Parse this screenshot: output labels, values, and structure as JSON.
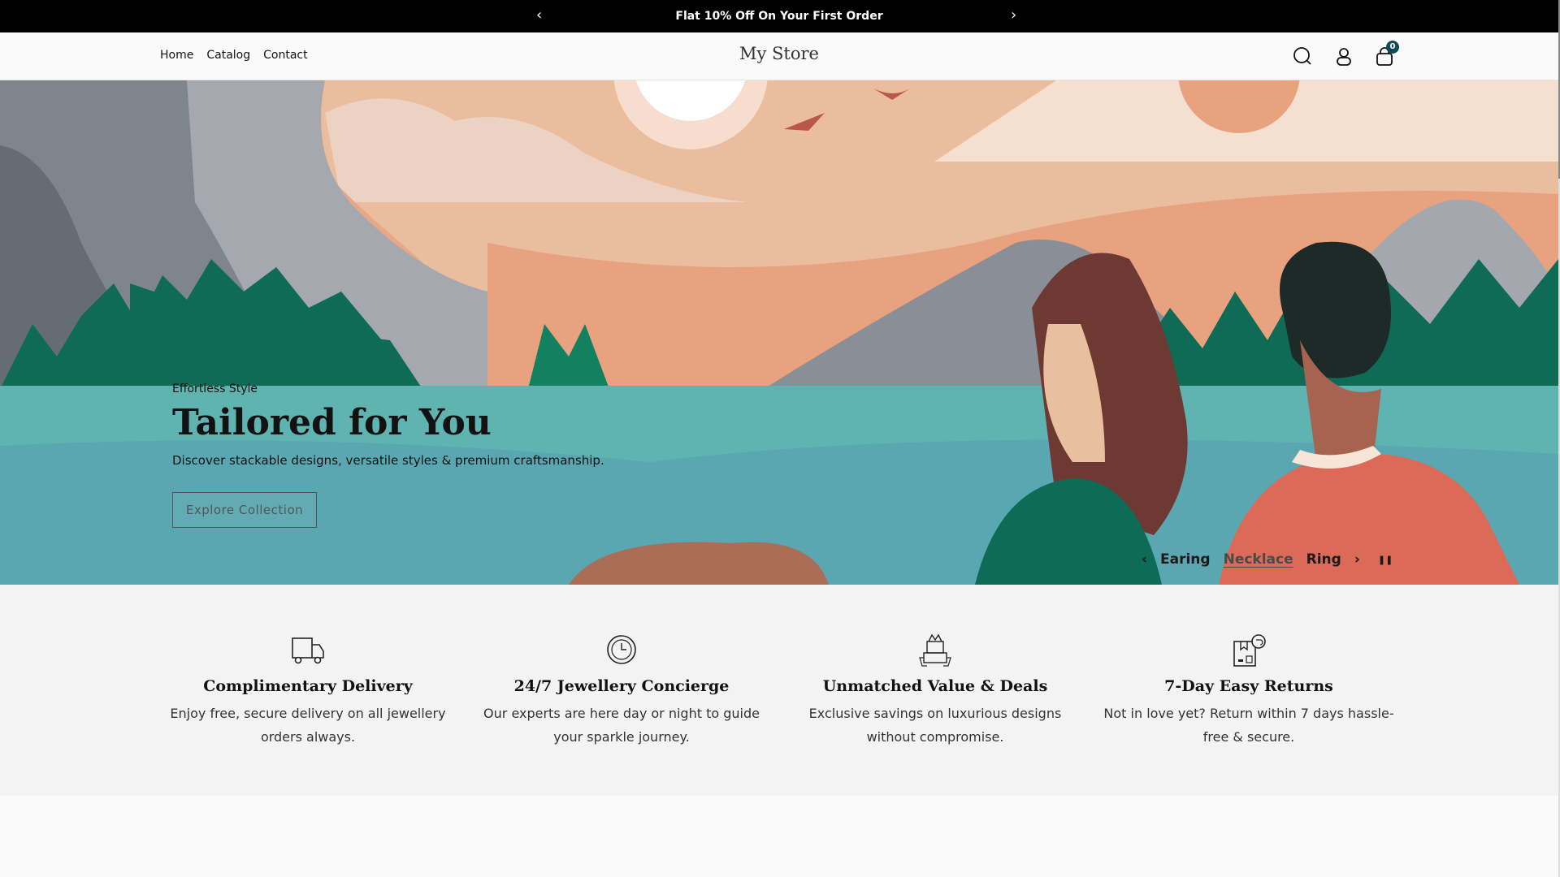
{
  "announcement": {
    "text": "Flat 10% Off On Your First Order",
    "prev": "‹",
    "next": "›"
  },
  "header": {
    "logo": "My Store",
    "nav": [
      "Home",
      "Catalog",
      "Contact"
    ],
    "cart_count": "0"
  },
  "hero": {
    "eyebrow": "Effortless Style",
    "title": "Tailored for You",
    "description": "Discover stackable designs, versatile styles & premium craftsmanship.",
    "button": "Explore Collection",
    "slides": [
      "Earing",
      "Necklace",
      "Ring"
    ],
    "active_slide": "Necklace",
    "prev": "‹",
    "next": "›",
    "pause": "❚❚"
  },
  "features": [
    {
      "icon": "truck-icon",
      "title": "Complimentary Delivery",
      "desc": "Enjoy free, secure delivery on all jewellery orders always."
    },
    {
      "icon": "clock-icon",
      "title": "24/7 Jewellery Concierge",
      "desc": "Our experts are here day or night to guide your sparkle journey."
    },
    {
      "icon": "best-price-icon",
      "title": "Unmatched Value & Deals",
      "desc": "Exclusive savings on luxurious designs without compromise."
    },
    {
      "icon": "return-box-icon",
      "title": "7-Day Easy Returns",
      "desc": "Not in love yet? Return within 7 days hassle-free & secure."
    }
  ]
}
